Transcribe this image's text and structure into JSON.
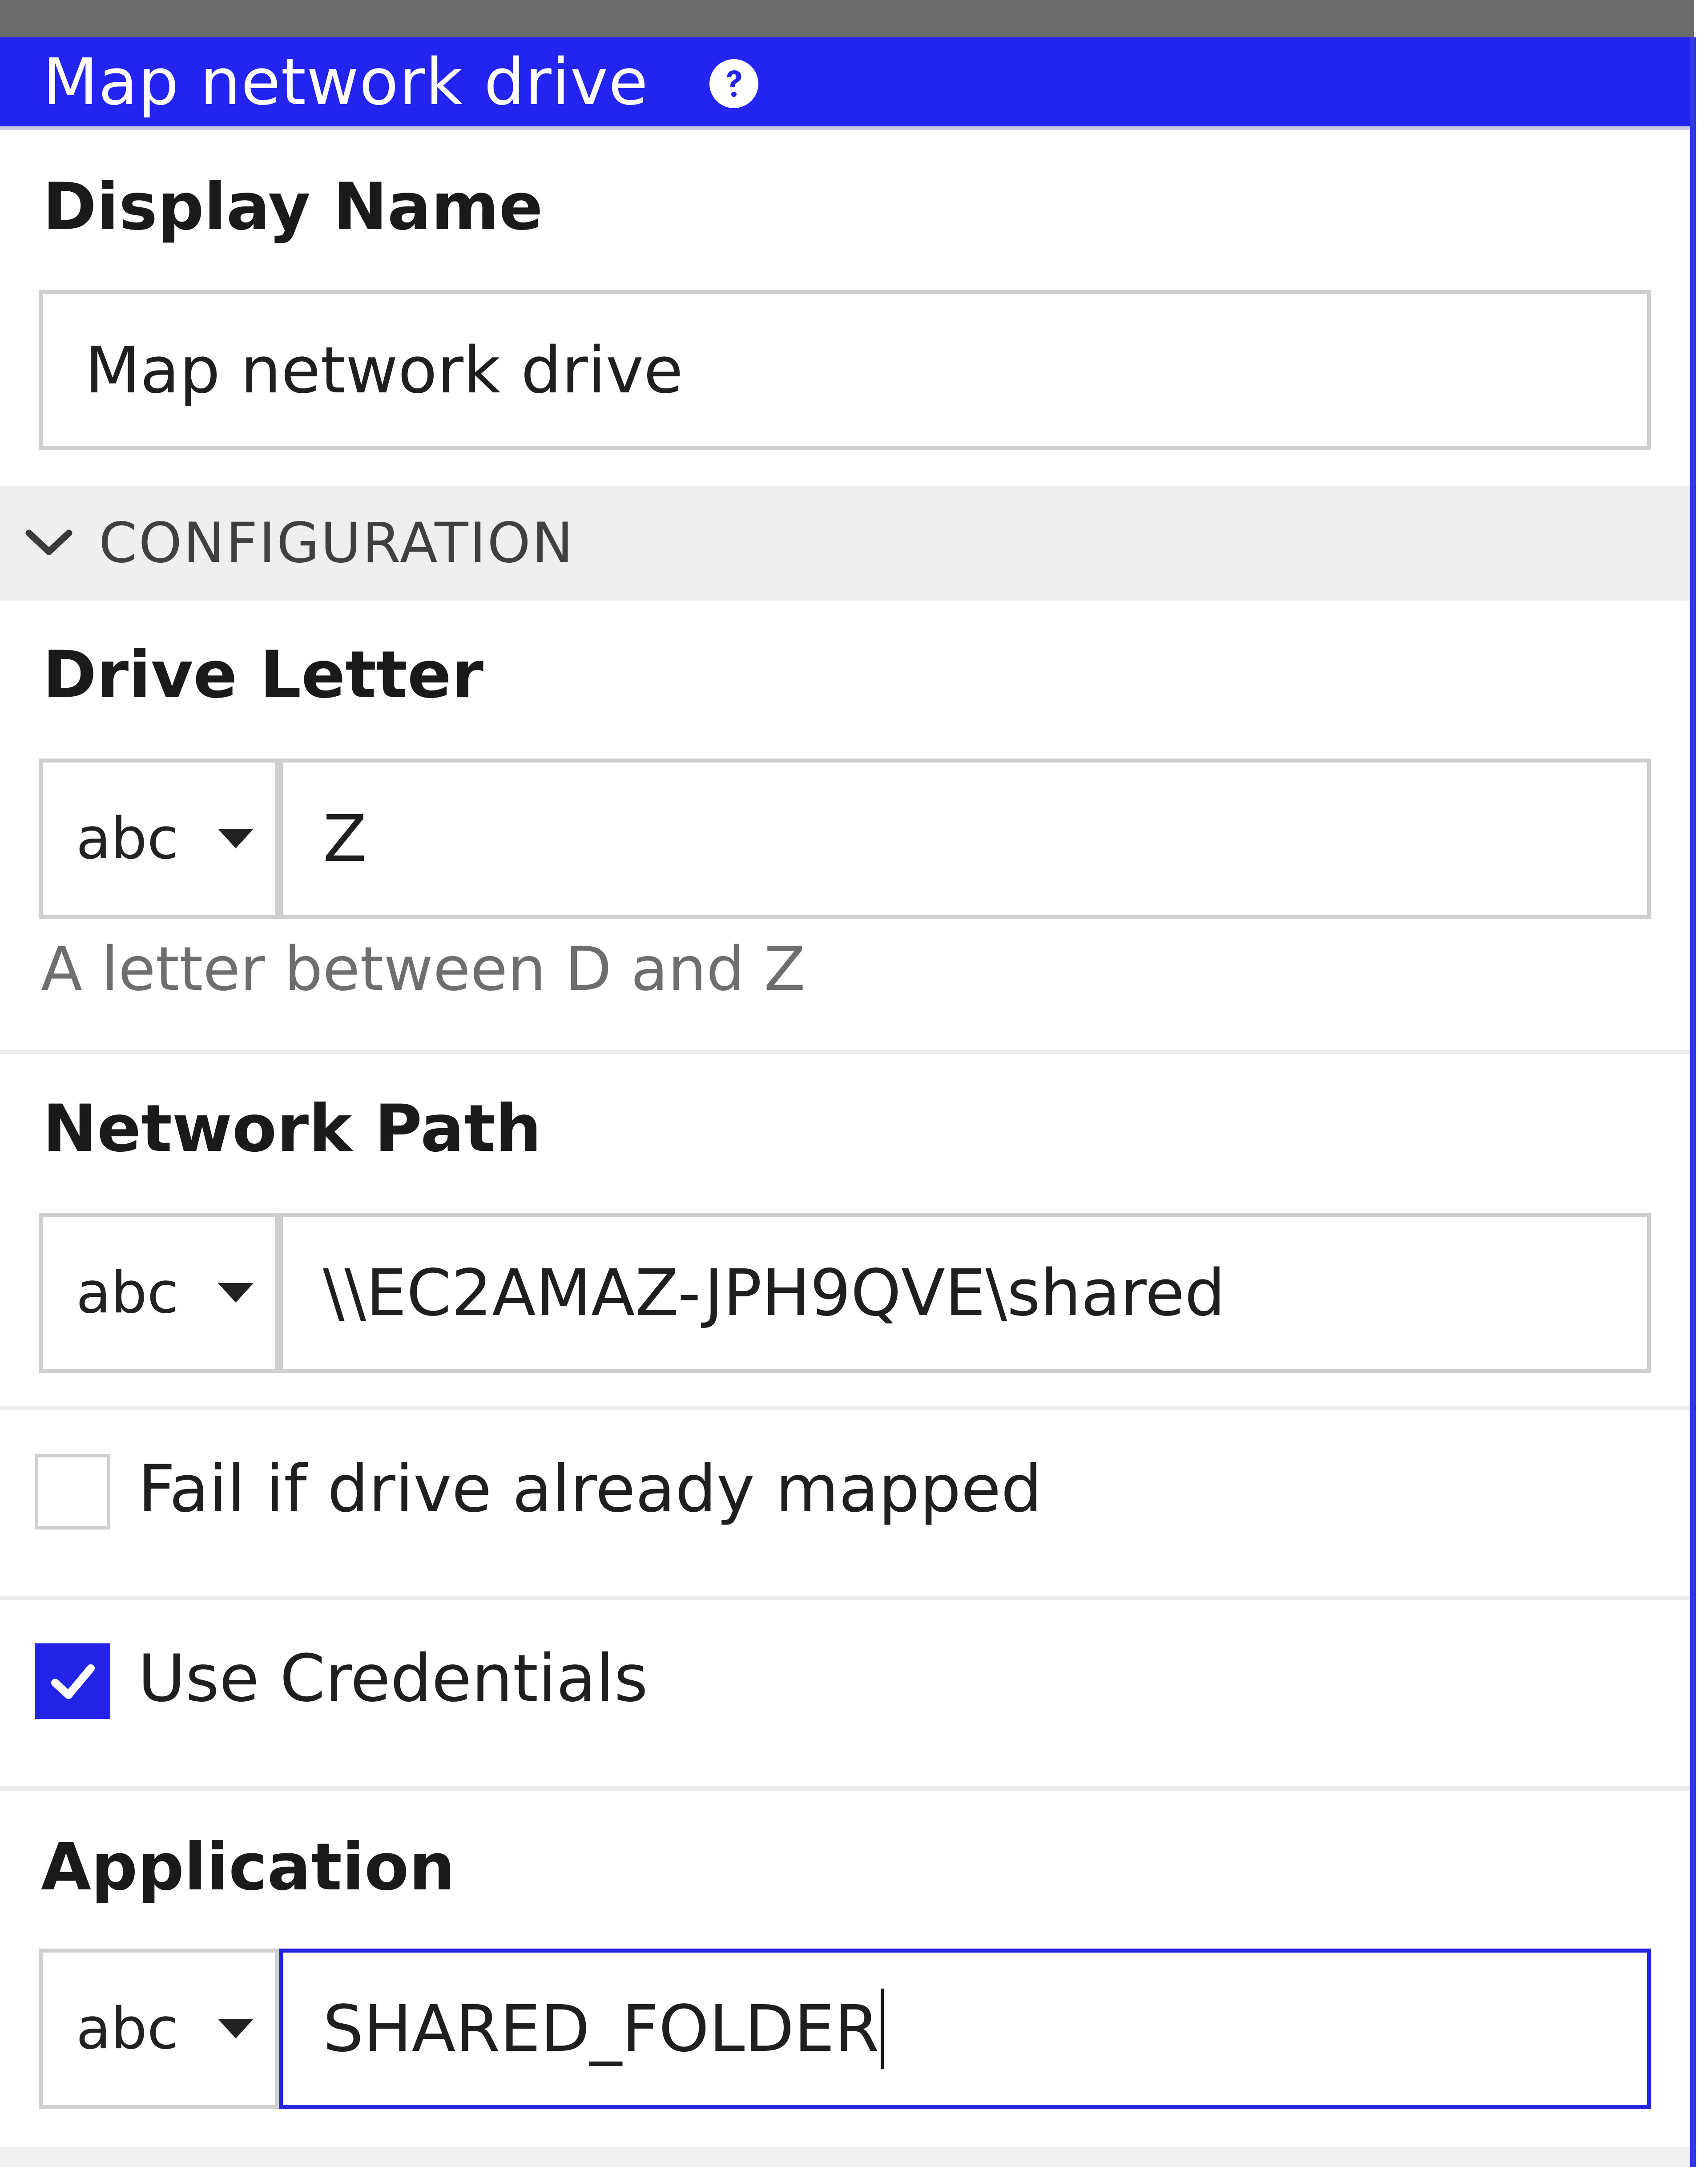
{
  "dialog": {
    "title": "Map network drive",
    "help_icon": "question-circle-icon",
    "accent_color": "#2424f0"
  },
  "display_name": {
    "label": "Display Name",
    "value": "Map network drive"
  },
  "configuration": {
    "label": "CONFIGURATION",
    "expanded": true,
    "chevron_icon": "chevron-down-icon"
  },
  "drive_letter": {
    "label": "Drive Letter",
    "type": "abc",
    "value": "Z",
    "hint": "A letter between D and Z"
  },
  "network_path": {
    "label": "Network Path",
    "type": "abc",
    "value": "\\\\EC2AMAZ-JPH9QVE\\shared"
  },
  "fail_if_mapped": {
    "label": "Fail if drive already mapped",
    "checked": false
  },
  "use_credentials": {
    "label": "Use Credentials",
    "checked": true,
    "check_icon": "checkmark-icon"
  },
  "application": {
    "label": "Application",
    "type": "abc",
    "value": "SHARED_FOLDER",
    "focused": true
  }
}
